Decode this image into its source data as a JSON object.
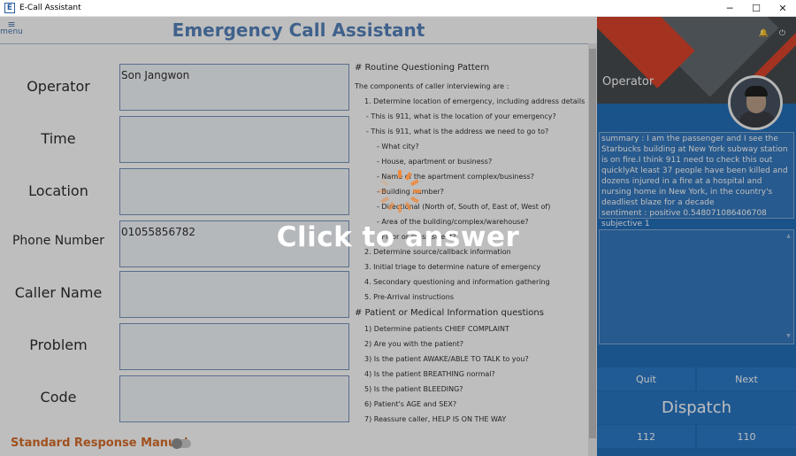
{
  "window": {
    "icon_letter": "E",
    "title": "E-Call Assistant",
    "minimize": "─",
    "maximize": "☐",
    "close": "✕"
  },
  "menu": {
    "icon": "≡",
    "label": "menu"
  },
  "header": {
    "title": "Emergency Call Assistant"
  },
  "form": {
    "operator_label": "Operator",
    "operator_value": "Son Jangwon",
    "time_label": "Time",
    "time_value": "",
    "location_label": "Location",
    "location_value": "",
    "phone_label": "Phone Number",
    "phone_value": "01055856782",
    "caller_label": "Caller Name",
    "caller_value": "",
    "problem_label": "Problem",
    "problem_value": "",
    "code_label": "Code",
    "code_value": ""
  },
  "guide": {
    "lines": [
      "# Routine Questioning Pattern",
      "The components of caller interviewing are :",
      "1. Determine location of emergency, including address details",
      "- This is 911, what is the location of your emergency?",
      "- This is 911, what is the address we need to go to?",
      "- What city?",
      "- House, apartment or business?",
      "- Name of the apartment complex/business?",
      "- Building number?",
      "- Directional (North of, South of, East of, West of)",
      "- Area of the building/complex/warehouse?",
      "- Floor or cross street?",
      "2. Determine source/callback information",
      "3. Initial triage to determine nature of emergency",
      "4. Secondary questioning and information gathering",
      "5. Pre-Arrival instructions",
      "# Patient or Medical Information questions",
      "1) Determine patients CHIEF COMPLAINT",
      "2) Are you with the patient?",
      "3) Is the patient AWAKE/ABLE TO TALK to you?",
      "4) Is the patient BREATHING normal?",
      "5) Is the patient BLEEDING?",
      "6) Patient's AGE and SEX?",
      "7) Reassure caller, HELP IS ON THE WAY"
    ]
  },
  "footer": {
    "manual_label": "Standard Response Manual",
    "manual_toggle_on": false
  },
  "side": {
    "bell_icon": "🔔",
    "power_icon": "⏻",
    "operator_title": "Operator",
    "summary_text": "summary : I am the passenger and I see the Starbucks building at New York subway station is on fire.I think 911 need to check this out quicklyAt least 37 people have been killed and dozens injured in a fire at a hospital and nursing home in New York, in the country's deadliest blaze for a decade\nsentiment : positive 0.548071086406708\nsubjective 1",
    "notes_text": "",
    "quit_label": "Quit",
    "next_label": "Next",
    "dispatch_label": "Dispatch",
    "btn_112": "112",
    "btn_110": "110"
  },
  "overlay": {
    "answer_label": "Click to answer"
  },
  "colors": {
    "heading": "#4a7ab8",
    "manual": "#d5641c",
    "side_panel": "#1565b5",
    "accent_red": "#d9381e",
    "spinner": "#f08a3c"
  }
}
